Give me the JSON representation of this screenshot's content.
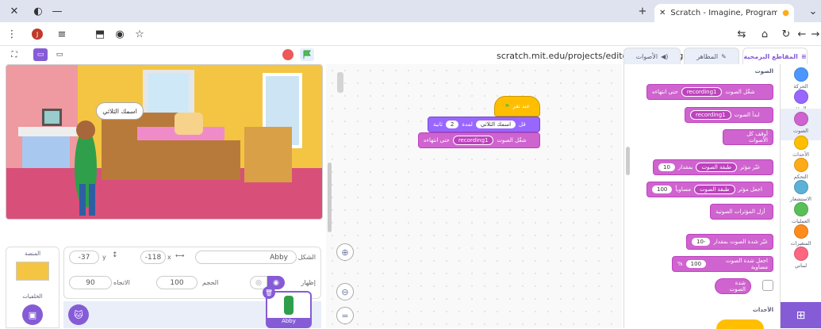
{
  "browser": {
    "tab_title": "Scratch - Imagine, Program, Sh",
    "url": "scratch.mit.edu/projects/editor/?tutorial=getStarted",
    "avatar_letter": "J"
  },
  "stage": {
    "speech": "اسمك الثلاثي"
  },
  "sprite_info": {
    "sprite_label": "الشكل",
    "sprite_name": "Abby",
    "x_label": "x",
    "x_value": "-118",
    "y_label": "y",
    "y_value": "-37",
    "show_label": "إظهار",
    "size_label": "الحجم",
    "size_value": "100",
    "direction_label": "الاتجاه",
    "direction_value": "90"
  },
  "stage_pane": {
    "title": "المنصة",
    "backdrops_label": "الخلفيات"
  },
  "sprite_list": {
    "selected_sprite": "Abby"
  },
  "tabs": {
    "code": "المقاطع البرمجية",
    "costumes": "المظاهر",
    "sounds": "الأصوات"
  },
  "palette": {
    "sound_header": "الصوت",
    "events_header": "الأحداث",
    "blocks": [
      {
        "text": "شغّل الصوت",
        "drop": "recording1",
        "after": "حتى انتهاءه"
      },
      {
        "text": "ابدأ الصوت",
        "drop": "recording1",
        "after": ""
      },
      {
        "text": "أوقف كل الأصوات",
        "drop": "",
        "after": ""
      },
      {
        "text": "غيّر مؤثر",
        "drop": "طبقة الصوت",
        "after": "بمقدار",
        "val": "10"
      },
      {
        "text": "اجعل مؤثر",
        "drop": "طبقة الصوت",
        "after": "مساوياً",
        "val": "100"
      },
      {
        "text": "أزل المؤثرات الصوتية",
        "drop": "",
        "after": ""
      },
      {
        "text": "غيّر شدة الصوت بمقدار",
        "val": "-10"
      },
      {
        "text": "اجعل شدة الصوت مساوية",
        "val": "100",
        "suffix": "%"
      },
      {
        "text": "شدة الصوت"
      }
    ]
  },
  "categories": [
    {
      "label": "الحركة",
      "color": "#4c97ff"
    },
    {
      "label": "الهيئة",
      "color": "#9966ff"
    },
    {
      "label": "الصوت",
      "color": "#cf63cf"
    },
    {
      "label": "الأحداث",
      "color": "#ffbf00"
    },
    {
      "label": "التحكم",
      "color": "#ffab19"
    },
    {
      "label": "الاستشعار",
      "color": "#5cb1d6"
    },
    {
      "label": "العمليات",
      "color": "#59c059"
    },
    {
      "label": "المتغيرات",
      "color": "#ff8c1a"
    },
    {
      "label": "لبناتي",
      "color": "#ff6680"
    }
  ],
  "script": {
    "hat": "عند نقر",
    "say_prefix": "قل",
    "say_text": "اسمك الثلاثي",
    "say_mid": "لمدة",
    "say_secs": "2",
    "say_suffix": "ثانية",
    "play_text": "شغّل الصوت",
    "play_drop": "recording1",
    "play_after": "حتى انتهاءه"
  }
}
